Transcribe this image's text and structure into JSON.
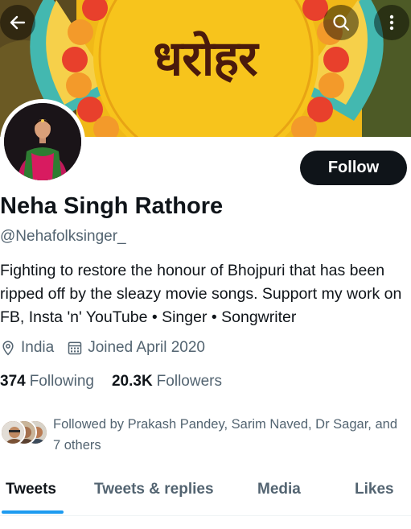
{
  "banner": {
    "title": "धरोहर",
    "colors": {
      "background": "#f3c21b",
      "petal_red": "#e8402c",
      "petal_orange": "#f39a2a",
      "teal": "#43b8b0",
      "sun": "#f7c41c"
    }
  },
  "header": {
    "back_icon": "arrow-left-icon",
    "search_icon": "search-icon",
    "more_icon": "more-vertical-icon"
  },
  "profile": {
    "name": "Neha Singh Rathore",
    "handle": "@Nehafolksinger_",
    "bio": "Fighting to restore the honour of Bhojpuri that has been ripped off by the sleazy movie songs. Support my work on FB, Insta 'n' YouTube • Singer • Songwriter",
    "location": "India",
    "joined": "Joined April 2020",
    "following_count": "374",
    "following_label": "Following",
    "followers_count": "20.3K",
    "followers_label": "Followers",
    "followed_by": "Followed by Prakash Pandey, Sarim Naved, Dr Sagar, and 7 others"
  },
  "actions": {
    "follow_label": "Follow"
  },
  "tabs": [
    {
      "label": "Tweets",
      "active": true
    },
    {
      "label": "Tweets & replies",
      "active": false
    },
    {
      "label": "Media",
      "active": false
    },
    {
      "label": "Likes",
      "active": false
    }
  ],
  "theme": {
    "text_primary": "#0f1419",
    "text_secondary": "#536471",
    "accent": "#1d9bf0",
    "button_dark": "#0f1419"
  }
}
